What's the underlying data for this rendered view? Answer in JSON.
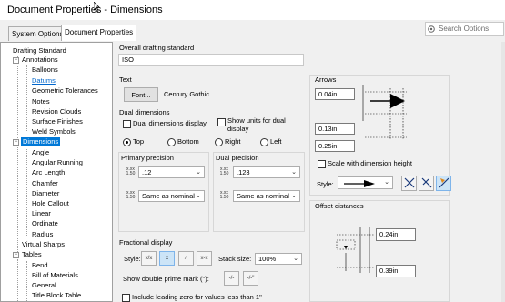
{
  "window": {
    "title": "Document Properties - Dimensions"
  },
  "tabs": [
    {
      "label": "System Options"
    },
    {
      "label": "Document Properties"
    }
  ],
  "search": {
    "placeholder": "Search Options"
  },
  "tree": {
    "items": [
      {
        "label": "Drafting Standard"
      },
      {
        "label": "Annotations"
      },
      {
        "label": "Balloons"
      },
      {
        "label": "Datums"
      },
      {
        "label": "Geometric Tolerances"
      },
      {
        "label": "Notes"
      },
      {
        "label": "Revision Clouds"
      },
      {
        "label": "Surface Finishes"
      },
      {
        "label": "Weld Symbols"
      },
      {
        "label": "Dimensions"
      },
      {
        "label": "Angle"
      },
      {
        "label": "Angular Running"
      },
      {
        "label": "Arc Length"
      },
      {
        "label": "Chamfer"
      },
      {
        "label": "Diameter"
      },
      {
        "label": "Hole Callout"
      },
      {
        "label": "Linear"
      },
      {
        "label": "Ordinate"
      },
      {
        "label": "Radius"
      },
      {
        "label": "Virtual Sharps"
      },
      {
        "label": "Tables"
      },
      {
        "label": "Bend"
      },
      {
        "label": "Bill of Materials"
      },
      {
        "label": "General"
      },
      {
        "label": "Title Block Table"
      }
    ]
  },
  "overall": {
    "label": "Overall drafting standard",
    "value": "ISO"
  },
  "text": {
    "label": "Text",
    "font_button": "Font...",
    "font_name": "Century Gothic"
  },
  "dual": {
    "label": "Dual dimensions",
    "display_label": "Dual dimensions display",
    "units_label": "Show units for dual display",
    "radios": [
      "Top",
      "Bottom",
      "Right",
      "Left"
    ],
    "selected": "Top"
  },
  "primary_precision": {
    "label": "Primary precision",
    "value": ".12",
    "tolerance": "Same as nominal"
  },
  "dual_precision": {
    "label": "Dual precision",
    "value": ".123",
    "tolerance": "Same as nominal"
  },
  "fractional": {
    "label": "Fractional display",
    "style_label": "Style:",
    "stack_label": "Stack size:",
    "stack_value": "100%",
    "double_prime_label": "Show double prime mark (\"):",
    "leading_zero_label": "Include leading zero for values less than 1\""
  },
  "arrows": {
    "label": "Arrows",
    "size1": "0.04in",
    "size2": "0.13in",
    "size3": "0.25in",
    "scale_label": "Scale with dimension height",
    "style_label": "Style:"
  },
  "offset": {
    "label": "Offset distances",
    "value1": "0.24in",
    "value2": "0.39in"
  },
  "icons": {
    "search": "search-icon",
    "arrow_style": "filled-arrow-icon"
  },
  "colors": {
    "selection": "#0078d7",
    "link": "#0066cc"
  }
}
